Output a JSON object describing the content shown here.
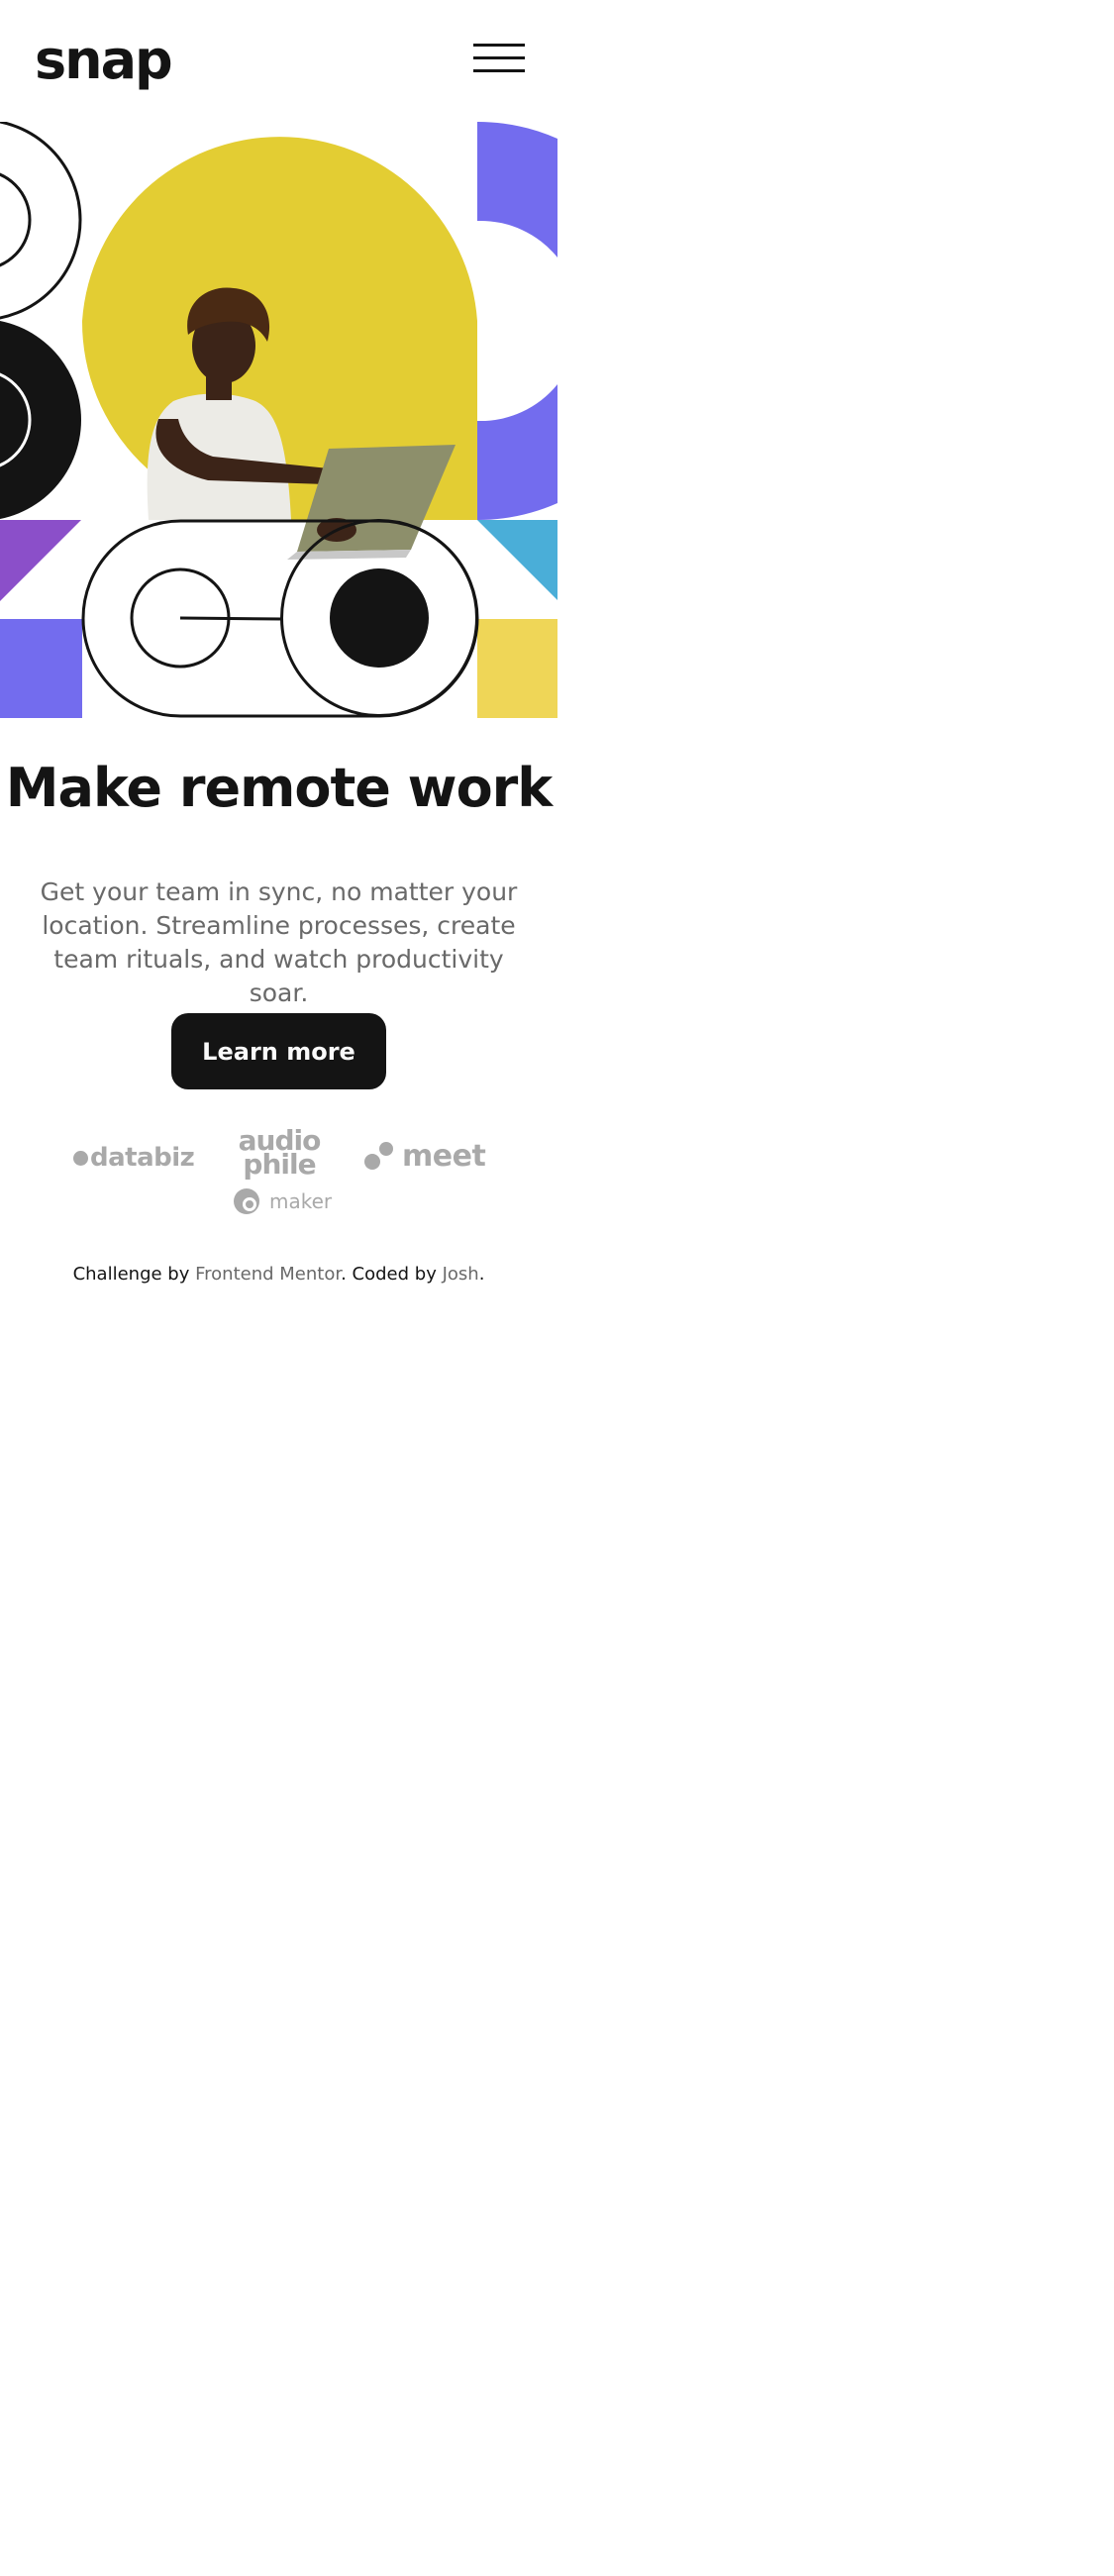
{
  "header": {
    "logo": "snap",
    "menu_icon": "hamburger-menu-icon"
  },
  "hero": {
    "headline": "Make remote work",
    "description": "Get your team in sync, no matter your location. Streamline processes, create team rituals, and watch productivity soar.",
    "cta_label": "Learn more",
    "image_icon": "person-with-laptop-illustration",
    "colors": {
      "yellow": "#e3cd33",
      "violet": "#736cee",
      "purple": "#8b4fc9",
      "blue": "#4aaed8",
      "light_yellow": "#efd657",
      "black": "#141414"
    }
  },
  "clients": {
    "databiz": "databiz",
    "audiophile_top": "audio",
    "audiophile_bottom": "phile",
    "meet": "meet",
    "maker": "maker"
  },
  "attribution": {
    "prefix": "Challenge by ",
    "challenge_link": "Frontend Mentor",
    "middle": ". Coded by ",
    "author_link": "Josh",
    "suffix": "."
  }
}
